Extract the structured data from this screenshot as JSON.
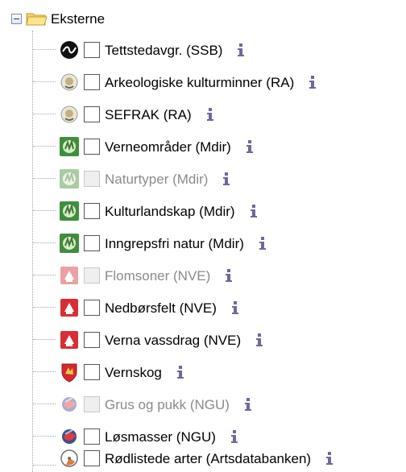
{
  "tree": {
    "root": {
      "label": "Eksterne",
      "expanded": true
    },
    "items": [
      {
        "label": "Tettstedavgr. (SSB)",
        "icon": "ssb-logo-icon",
        "enabled": true
      },
      {
        "label": "Arkeologiske kulturminner (RA)",
        "icon": "riksantikvaren-logo-icon",
        "enabled": true
      },
      {
        "label": "SEFRAK (RA)",
        "icon": "riksantikvaren-logo-icon",
        "enabled": true
      },
      {
        "label": "Verneområder (Mdir)",
        "icon": "miljodirektoratet-logo-icon",
        "enabled": true
      },
      {
        "label": "Naturtyper (Mdir)",
        "icon": "miljodirektoratet-logo-icon",
        "enabled": false
      },
      {
        "label": "Kulturlandskap (Mdir)",
        "icon": "miljodirektoratet-logo-icon",
        "enabled": true
      },
      {
        "label": "Inngrepsfri natur (Mdir)",
        "icon": "miljodirektoratet-logo-icon",
        "enabled": true
      },
      {
        "label": "Flomsoner (NVE)",
        "icon": "nve-logo-icon",
        "enabled": false
      },
      {
        "label": "Nedbørsfelt (NVE)",
        "icon": "nve-logo-icon",
        "enabled": true
      },
      {
        "label": "Verna vassdrag (NVE)",
        "icon": "nve-logo-icon",
        "enabled": true
      },
      {
        "label": "Vernskog",
        "icon": "shield-crest-icon",
        "enabled": true
      },
      {
        "label": "Grus og pukk (NGU)",
        "icon": "ngu-logo-icon",
        "enabled": false
      },
      {
        "label": "Løsmasser (NGU)",
        "icon": "ngu-logo-icon",
        "enabled": true
      },
      {
        "label": "Rødlistede arter (Artsdatabanken)",
        "icon": "artsdatabanken-logo-icon",
        "enabled": true
      }
    ],
    "info_icon": "info-icon"
  },
  "colors": {
    "info": "#6c6a9b",
    "tree_lines": "#9ea7b5",
    "disabled_text": "#8b8b8b"
  }
}
